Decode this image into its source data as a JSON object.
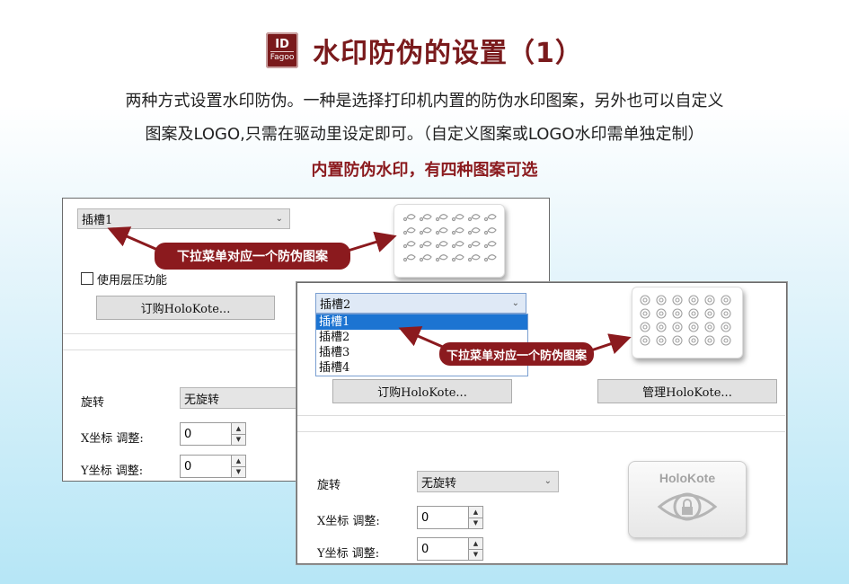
{
  "header": {
    "logo_top": "ID",
    "logo_bottom": "Fagoo",
    "title": "水印防伪的设置（1）"
  },
  "intro": {
    "line1": "两种方式设置水印防伪。一种是选择打印机内置的防伪水印图案，另外也可以自定义",
    "line2": "图案及LOGO,只需在驱动里设定即可。（自定义图案或LOGO水印需单独定制）"
  },
  "subtitle": "内置防伪水印，有四种图案可选",
  "colors": {
    "brand": "#7a1a1c",
    "callout": "#8b1a1e",
    "selection": "#1c74d2"
  },
  "panel1": {
    "slot_select": "插槽1",
    "layer_checkbox_label": "使用层压功能",
    "order_button": "订购HoloKote...",
    "rotation_label": "旋转",
    "rotation_value": "无旋转",
    "x_label": "X坐标 调整:",
    "x_value": "0",
    "y_label": "Y坐标 调整:",
    "y_value": "0",
    "callout": "下拉菜单对应一个防伪图案"
  },
  "panel2": {
    "slot_select": "插槽2",
    "slot_options": [
      "插槽1",
      "插槽2",
      "插槽3",
      "插槽4"
    ],
    "selected_option": "插槽1",
    "order_button": "订购HoloKote...",
    "manage_button": "管理HoloKote...",
    "rotation_label": "旋转",
    "rotation_value": "无旋转",
    "x_label": "X坐标 调整:",
    "x_value": "0",
    "y_label": "Y坐标 调整:",
    "y_value": "0",
    "callout": "下拉菜单对应一个防伪图案",
    "holokote_logo": "HoloKote"
  }
}
